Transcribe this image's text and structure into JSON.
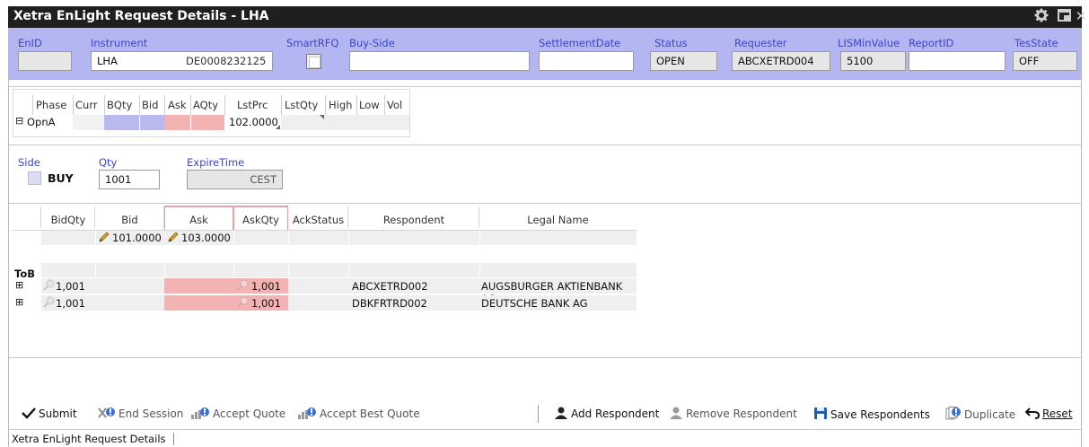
{
  "window": {
    "title": "Xetra EnLight Request Details - LHA"
  },
  "header": {
    "enid": {
      "label": "EnID",
      "value": ""
    },
    "instrument": {
      "label": "Instrument",
      "symbol": "LHA",
      "isin": "DE0008232125"
    },
    "smartrfq": {
      "label": "SmartRFQ",
      "checked": false
    },
    "buyside": {
      "label": "Buy-Side",
      "value": ""
    },
    "settlement": {
      "label": "SettlementDate",
      "value": ""
    },
    "status": {
      "label": "Status",
      "value": "OPEN"
    },
    "requester": {
      "label": "Requester",
      "value": "ABCXETRD004"
    },
    "lisminvalue": {
      "label": "LISMinValue",
      "value": "5100"
    },
    "reportid": {
      "label": "ReportID",
      "value": ""
    },
    "tesstate": {
      "label": "TesState",
      "value": "OFF"
    }
  },
  "market": {
    "columns": [
      "Phase",
      "Curr",
      "BQty",
      "Bid",
      "Ask",
      "AQty",
      "LstPrc",
      "LstQty",
      "High",
      "Low",
      "Vol"
    ],
    "row": {
      "expander": "⊟",
      "phase": "OpnA",
      "lastprice": "102.0000"
    }
  },
  "order": {
    "side_label": "Side",
    "side_value": "BUY",
    "qty_label": "Qty",
    "qty_value": "1001",
    "expire_label": "ExpireTime",
    "expire_value": "CEST"
  },
  "quotes": {
    "columns": [
      "BidQty",
      "Bid",
      "Ask",
      "AskQty",
      "AckStatus",
      "Respondent",
      "Legal Name"
    ],
    "summary": {
      "bid": "101.0000",
      "ask": "103.0000"
    },
    "tob_label": "ToB",
    "rows": [
      {
        "expander": "⊞",
        "bidqty": "1,001",
        "askqty": "1,001",
        "respondent": "ABCXETRD002",
        "legal_name": "AUGSBURGER AKTIENBANK AG"
      },
      {
        "expander": "⊞",
        "bidqty": "1,001",
        "askqty": "1,001",
        "respondent": "DBKFRTRD002",
        "legal_name": "DEUTSCHE BANK AG"
      }
    ]
  },
  "toolbar": {
    "submit": "Submit",
    "end_session": "End Session",
    "accept_quote": "Accept Quote",
    "accept_best_quote": "Accept Best Quote",
    "add_respondent": "Add Respondent",
    "remove_respondent": "Remove Respondent",
    "save_respondents": "Save Respondents",
    "duplicate": "Duplicate",
    "reset": "Reset"
  },
  "statusbar": {
    "tab": "Xetra EnLight Request Details"
  },
  "colors": {
    "header_band": "#b4b6f2",
    "label_blue": "#3a46c8",
    "ask_pink": "#f3b3b3",
    "bid_lavender": "#b9b9ee",
    "titlebar": "#1f1f1f"
  }
}
